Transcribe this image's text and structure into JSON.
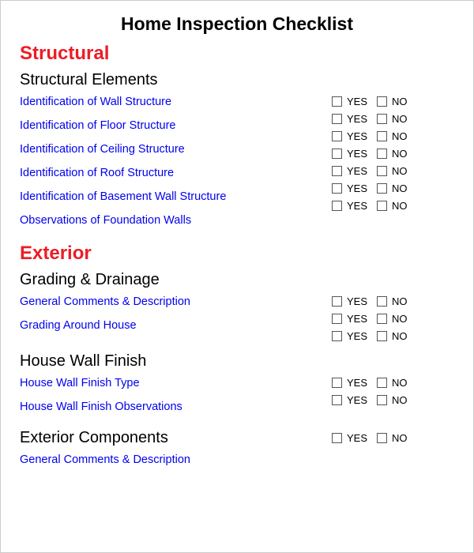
{
  "title": "Home Inspection Checklist",
  "yes": "YES",
  "no": "NO",
  "sections": [
    {
      "header": "Structural",
      "subsections": [
        {
          "header": "Structural Elements",
          "items": [
            "Identification of Wall Structure",
            "Identification of Floor Structure",
            "Identification of Ceiling Structure",
            "Identification of Roof Structure",
            "Identification of Basement Wall Structure",
            "Observations of Foundation Walls"
          ],
          "checkRows": 7
        }
      ]
    },
    {
      "header": "Exterior",
      "subsections": [
        {
          "header": "Grading & Drainage",
          "items": [
            "General Comments & Description",
            "Grading Around House"
          ],
          "checkRows": 3
        },
        {
          "header": "House Wall Finish",
          "items": [
            "House Wall Finish Type",
            "House Wall Finish Observations"
          ],
          "checkRows": 2
        },
        {
          "header": "Exterior Components",
          "items": [
            "General Comments & Description"
          ],
          "checkRows": 1,
          "inlineCheck": true
        }
      ]
    }
  ]
}
